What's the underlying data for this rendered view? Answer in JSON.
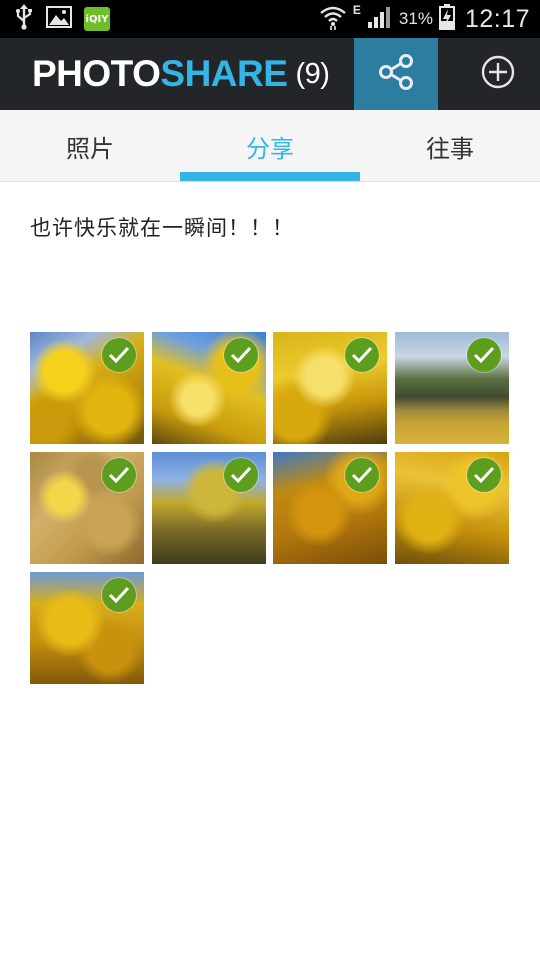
{
  "status_bar": {
    "icons": [
      "usb-icon",
      "gallery-icon",
      "iqiyi-icon"
    ],
    "iqiyi_label": "iQIY",
    "network_type": "E",
    "battery_percent": "31%",
    "time": "12:17"
  },
  "app_bar": {
    "title_part1": "PHOTO",
    "title_part2": "SHARE",
    "count": "(9)",
    "share_icon": "share-icon",
    "add_icon": "add-circle-icon",
    "colors": {
      "background": "#222628",
      "accent": "#33b5e5",
      "share_active": "#2c7da0"
    }
  },
  "tabs": [
    {
      "label": "照片",
      "active": false
    },
    {
      "label": "分享",
      "active": true
    },
    {
      "label": "往事",
      "active": false
    }
  ],
  "caption": "也许快乐就在一瞬间！！！",
  "photos": [
    {
      "selected": true,
      "icon": "check-icon"
    },
    {
      "selected": true,
      "icon": "check-icon"
    },
    {
      "selected": true,
      "icon": "check-icon"
    },
    {
      "selected": true,
      "icon": "check-icon"
    },
    {
      "selected": true,
      "icon": "check-icon"
    },
    {
      "selected": true,
      "icon": "check-icon"
    },
    {
      "selected": true,
      "icon": "check-icon"
    },
    {
      "selected": true,
      "icon": "check-icon"
    },
    {
      "selected": true,
      "icon": "check-icon"
    }
  ],
  "colors": {
    "check": "#5d9e1f"
  }
}
